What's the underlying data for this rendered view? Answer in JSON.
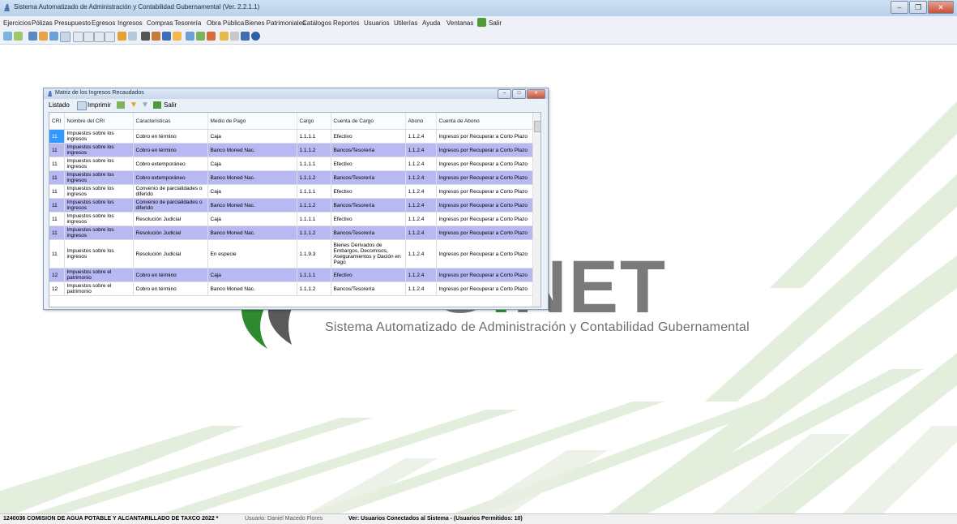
{
  "window": {
    "title": "Sistema Automatizado de Administración y Contabilidad Gubernamental  (Ver. 2.2.1.1)"
  },
  "menu": [
    "Ejercicios",
    "Pólizas",
    "Presupuesto",
    "Egresos",
    "Ingresos",
    "Compras",
    "Tesorería",
    "Obra Pública",
    "Bienes Patrimoniales",
    "Catálogos",
    "Reportes",
    "Usuarios",
    "Utilerías",
    "Ayuda",
    "Ventanas",
    "Salir"
  ],
  "logo": {
    "text_main": "G",
    "text_dot": ".",
    "text_end": "NET",
    "subtitle": "Sistema Automatizado de Administración y Contabilidad Gubernamental"
  },
  "child": {
    "title": "Matriz de los Ingresos Recaudados",
    "toolbar": {
      "listado": "Listado",
      "imprimir": "Imprimir",
      "salir": "Salir"
    },
    "columns": [
      "CRI",
      "Nombre del CRI",
      "Caracteristicas",
      "Medio de Pago",
      "Cargo",
      "Cuenta de Cargo",
      "Abono",
      "Cuenta de Abono"
    ],
    "rows": [
      [
        "11",
        "Impuestos sobre los ingresos",
        "Cobro en término",
        "Caja",
        "1.1.1.1",
        "Efectivo",
        "1.1.2.4",
        "Ingresos por Recuperar a Corto Plazo"
      ],
      [
        "11",
        "Impuestos sobre los ingresos",
        "Cobro en término",
        "Banco Moned Nac.",
        "1.1.1.2",
        "Bancos/Tesorería",
        "1.1.2.4",
        "Ingresos por Recuperar a Corto Plazo"
      ],
      [
        "11",
        "Impuestos sobre los ingresos",
        "Cobro extemporáneo",
        "Caja",
        "1.1.1.1",
        "Efectivo",
        "1.1.2.4",
        "Ingresos por Recuperar a Corto Plazo"
      ],
      [
        "11",
        "Impuestos sobre los ingresos",
        "Cobro extemporáneo",
        "Banco Moned Nac.",
        "1.1.1.2",
        "Bancos/Tesorería",
        "1.1.2.4",
        "Ingresos por Recuperar a Corto Plazo"
      ],
      [
        "11",
        "Impuestos sobre los ingresos",
        "Convenio de parcialidades o diferido",
        "Caja",
        "1.1.1.1",
        "Efectivo",
        "1.1.2.4",
        "Ingresos por Recuperar a Corto Plazo"
      ],
      [
        "11",
        "Impuestos sobre los ingresos",
        "Convenio de parcialidades o diferido",
        "Banco Moned Nac.",
        "1.1.1.2",
        "Bancos/Tesorería",
        "1.1.2.4",
        "Ingresos por Recuperar a Corto Plazo"
      ],
      [
        "11",
        "Impuestos sobre los ingresos",
        "Resolución Judicial",
        "Caja",
        "1.1.1.1",
        "Efectivo",
        "1.1.2.4",
        "Ingresos por Recuperar a Corto Plazo"
      ],
      [
        "11",
        "Impuestos sobre los ingresos",
        "Resolución Judicial",
        "Banco Moned Nac.",
        "1.1.1.2",
        "Bancos/Tesorería",
        "1.1.2.4",
        "Ingresos por Recuperar a Corto Plazo"
      ],
      [
        "11",
        "Impuestos sobre los ingresos",
        "Resolución Judicial",
        "En especie",
        "1.1.9.3",
        "Bienes Derivados de Embargos, Decomisos, Aseguramientos y Dación en Pago",
        "1.1.2.4",
        "Ingresos por Recuperar a Corto Plazo"
      ],
      [
        "12",
        "Impuestos sobre el patrimonio",
        "Cobro en término",
        "Caja",
        "1.1.1.1",
        "Efectivo",
        "1.1.2.4",
        "Ingresos por Recuperar a Corto Plazo"
      ],
      [
        "12",
        "Impuestos sobre el patrimonio",
        "Cobro en término",
        "Banco Moned Nac.",
        "1.1.1.2",
        "Bancos/Tesorería",
        "1.1.2.4",
        "Ingresos por Recuperar a Corto Plazo"
      ]
    ]
  },
  "status": {
    "entity": "1240036 COMISION DE AGUA POTABLE Y ALCANTARILLADO DE TAXCO  2022  *",
    "user": "Usuario: Daniel Macedo Flores",
    "link": "Ver: Usuarios Conectados al Sistema - (Usuarios Permitidos: 10)"
  }
}
